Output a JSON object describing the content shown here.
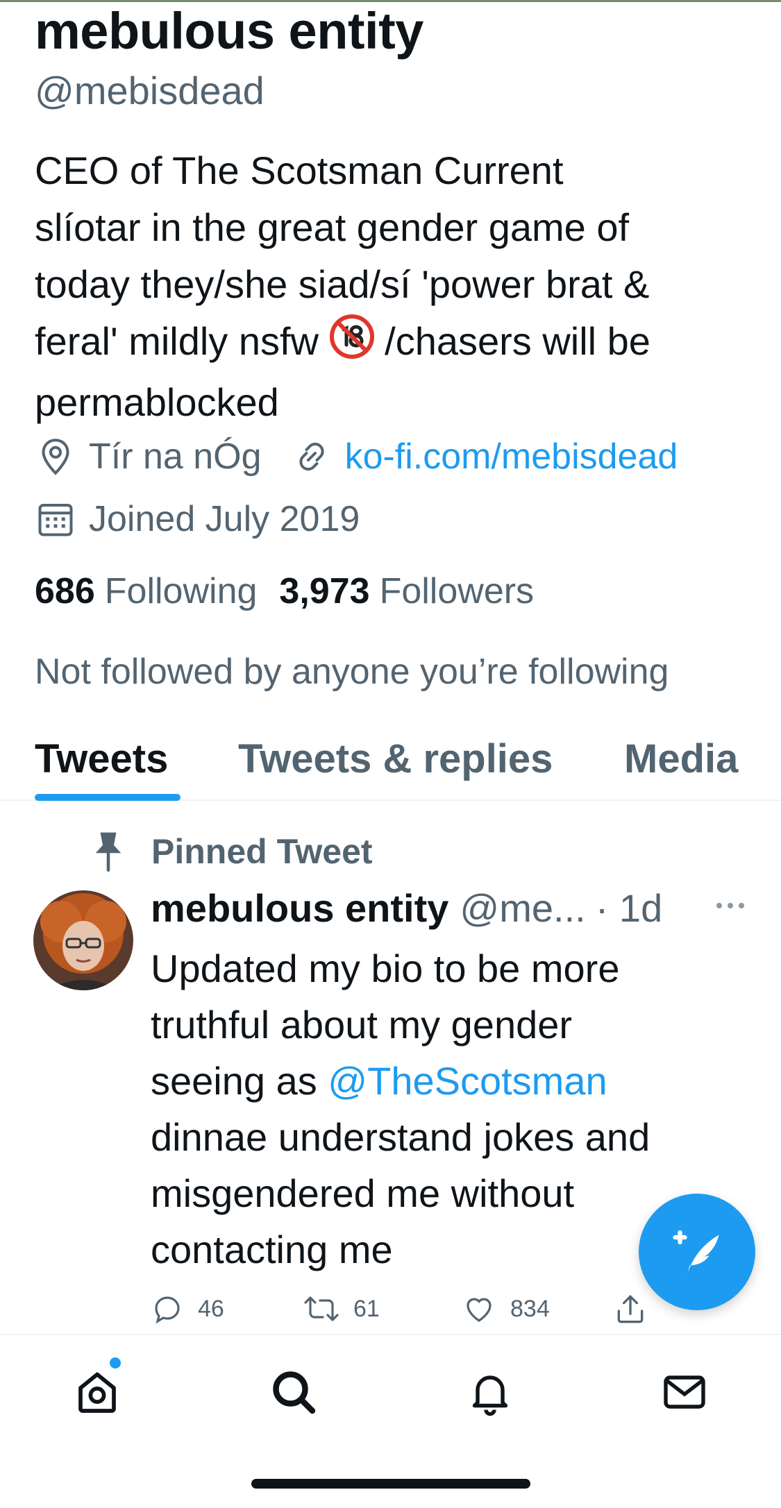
{
  "profile": {
    "display_name": "mebulous entity",
    "handle": "@mebisdead",
    "bio_line1": "CEO of The Scotsman Current",
    "bio_line2": "slíotar in the great gender game of",
    "bio_line3": "today they/she siad/sí 'power brat &",
    "bio_line4a": "feral' mildly nsfw ",
    "bio_line4b": " /chasers will be",
    "bio_line5": "permablocked",
    "location": "Tír na nÓg",
    "website": "ko-fi.com/mebisdead",
    "joined": "Joined July 2019",
    "following_count": "686",
    "following_label": "Following",
    "followers_count": "3,973",
    "followers_label": "Followers",
    "not_followed": "Not followed by anyone you’re following"
  },
  "tabs": [
    {
      "label": "Tweets",
      "active": true
    },
    {
      "label": "Tweets & replies",
      "active": false
    },
    {
      "label": "Media",
      "active": false
    }
  ],
  "pinned": {
    "label": "Pinned Tweet",
    "author_name": "mebulous entity",
    "author_handle": "@me...",
    "time": "· 1d",
    "text_line1": "Updated my bio to be more",
    "text_line2": "truthful about my gender",
    "text_line3a": "seeing as ",
    "mention": "@TheScotsman",
    "text_line4": "dinnae understand jokes and",
    "text_line5": "misgendered me without",
    "text_line6": "contacting me",
    "replies": "46",
    "retweets": "61",
    "likes": "834"
  },
  "nav": {
    "items": [
      "home-icon",
      "search-icon",
      "bell-icon",
      "mail-icon"
    ],
    "home_has_notification": true
  },
  "colors": {
    "accent": "#1d9bf0",
    "text_primary": "#0f1419",
    "text_secondary": "#536471"
  }
}
